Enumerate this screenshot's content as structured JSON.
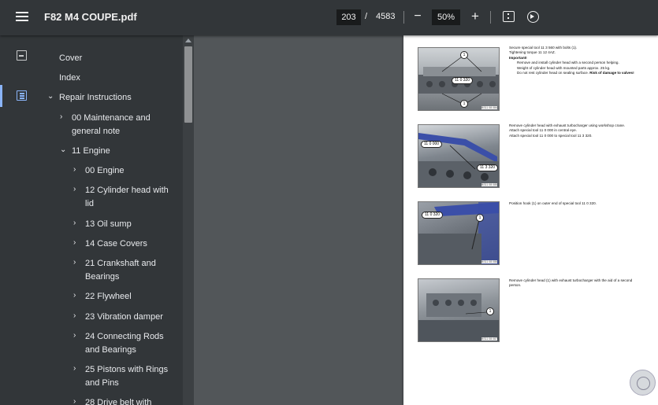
{
  "toolbar": {
    "title": "F82 M4 COUPE.pdf",
    "current_page": "203",
    "page_separator": "/",
    "total_pages": "4583",
    "zoom_out_label": "−",
    "zoom_value": "50%",
    "zoom_in_label": "+",
    "icons": [
      "menu-icon",
      "fit-page-icon",
      "rotate-icon"
    ]
  },
  "rail": {
    "icons": [
      "thumbnails-icon",
      "outline-icon"
    ],
    "active": "outline-icon"
  },
  "outline": {
    "items": [
      {
        "label": "Cover",
        "chevron": ""
      },
      {
        "label": "Index",
        "chevron": ""
      },
      {
        "label": "Repair Instructions",
        "chevron": "⌄"
      },
      {
        "label": "00 Maintenance and",
        "label2": "general note",
        "chevron": "›"
      },
      {
        "label": "11 Engine",
        "chevron": "⌄"
      },
      {
        "label": "00 Engine",
        "chevron": "›"
      },
      {
        "label": "12 Cylinder head with",
        "label2": "lid",
        "chevron": "›"
      },
      {
        "label": "13 Oil sump",
        "chevron": "›"
      },
      {
        "label": "14 Case Covers",
        "chevron": "›"
      },
      {
        "label": "21 Crankshaft and",
        "label2": "Bearings",
        "chevron": "›"
      },
      {
        "label": "22 Flywheel",
        "chevron": "›"
      },
      {
        "label": "23 Vibration damper",
        "chevron": "›"
      },
      {
        "label": "24 Connecting Rods",
        "label2": "and Bearings",
        "chevron": "›"
      },
      {
        "label": "25 Pistons with Rings",
        "label2": "and Pins",
        "chevron": "›"
      },
      {
        "label": "28 Drive belt with",
        "chevron": "›"
      }
    ]
  },
  "page": {
    "steps": [
      {
        "lines": [
          "Secure special tool 11 3 560 with bolts (1).",
          "Tightening torque 11 12 4AZ."
        ],
        "important": "Important!",
        "indented": [
          "Remove and install cylinder head with a second person helping.",
          "Weight of cylinder head with mounted parts approx. 25 kg.",
          "Do not rest cylinder head on sealing surface."
        ],
        "warning": "Risk of damage to valves!",
        "callouts": [
          "1",
          "11 0 320",
          "1"
        ],
        "code": "BS11 08 084"
      },
      {
        "lines": [
          "Remove cylinder head with exhaust turbocharger using workshop crane.",
          "Attach special tool 11 0 000 in central eye.",
          "Attach special tool 11 0 000 to special tool 11 3 320."
        ],
        "callouts": [
          "11 0 000",
          "11 3 320"
        ],
        "code": "BS11 08 085"
      },
      {
        "lines": [
          "Position hook (1) on outer end of special tool 11 0 320."
        ],
        "callouts": [
          "11 0 320",
          "1"
        ],
        "code": "BS11 08 086"
      },
      {
        "lines": [
          "Remove cylinder head (1) with exhaust turbocharger with the aid of a second person."
        ],
        "callouts": [
          "1"
        ],
        "code": "BS11 08 087"
      }
    ]
  }
}
